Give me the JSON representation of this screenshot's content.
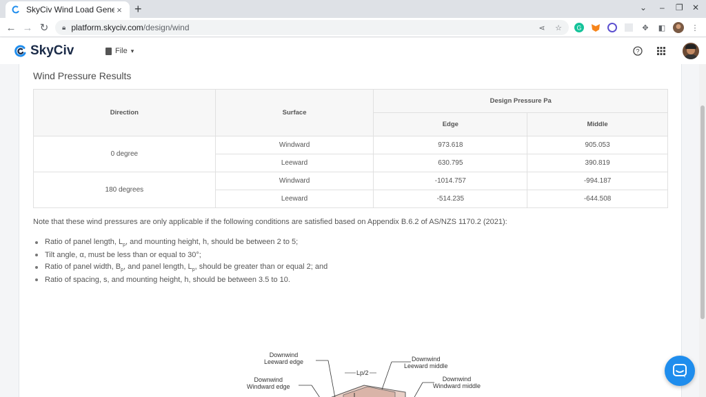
{
  "browser": {
    "tab_title": "SkyCiv Wind Load Generat",
    "tab_close": "×",
    "new_tab": "+",
    "url_host": "platform.skyciv.com",
    "url_path": "/design/wind"
  },
  "app": {
    "brand": "SkyCiv",
    "file_menu": "File",
    "brand_color": "#1a2a47",
    "accent_color": "#1f8ded"
  },
  "results": {
    "title": "Wind Pressure Results",
    "headers": {
      "direction": "Direction",
      "surface": "Surface",
      "design_pressure": "Design Pressure Pa",
      "edge": "Edge",
      "middle": "Middle"
    },
    "groups": [
      {
        "direction": "0 degree",
        "rows": [
          {
            "surface": "Windward",
            "edge": "973.618",
            "middle": "905.053"
          },
          {
            "surface": "Leeward",
            "edge": "630.795",
            "middle": "390.819"
          }
        ]
      },
      {
        "direction": "180 degrees",
        "rows": [
          {
            "surface": "Windward",
            "edge": "-1014.757",
            "middle": "-994.187"
          },
          {
            "surface": "Leeward",
            "edge": "-514.235",
            "middle": "-644.508"
          }
        ]
      }
    ]
  },
  "note": "Note that these wind pressures are only applicable if the following conditions are satisfied based on Appendix B.6.2 of AS/NZS 1170.2 (2021):",
  "conditions": {
    "c1_a": "Ratio of panel length, L",
    "c1_sub": "p",
    "c1_b": ", and mounting height, h, should be between 2 to 5;",
    "c2": "Tilt angle, α, must be less than or equal to 30°;",
    "c3_a": "Ratio of panel width, B",
    "c3_sub1": "p",
    "c3_b": ", and panel length, L",
    "c3_sub2": "p",
    "c3_c": ", should be greater than or equal 2; and",
    "c4": "Ratio of spacing, s, and mounting height, h, should be between 3.5 to 10."
  },
  "diagram": {
    "downwind_leeward_edge": "Downwind\nLeeward edge",
    "downwind_windward_edge": "Downwind\nWindward edge",
    "lp_half": "Lp/2",
    "downwind_leeward_middle": "Downwind\nLeeward middle",
    "downwind_windward_middle": "Downwind\nWindward middle"
  }
}
